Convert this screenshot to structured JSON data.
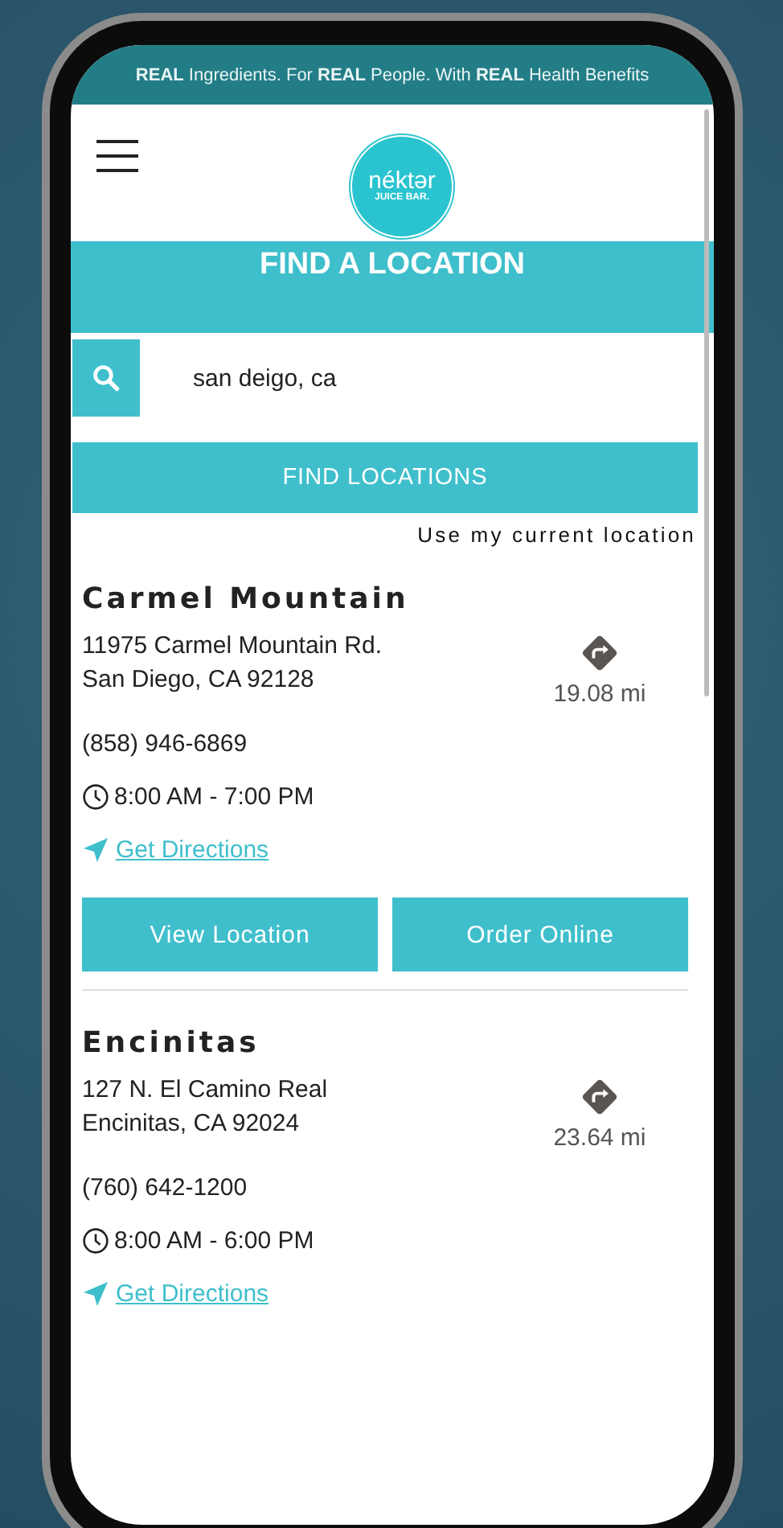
{
  "banner": "**REAL** Ingredients. For **REAL** People. With **REAL** Health Benefits",
  "logo": {
    "wordmark": "néktər",
    "tagline": "JUICE BAR."
  },
  "page_title": "FIND A LOCATION",
  "search": {
    "value": "san deigo, ca"
  },
  "find_button": "FIND LOCATIONS",
  "current_location_link": "Use my current location",
  "locations": [
    {
      "name": "Carmel Mountain",
      "address_line_1": "11975 Carmel Mountain Rd.",
      "address_line_2": "San Diego, CA 92128",
      "phone": "(858) 946-6869",
      "hours": "8:00 AM - 7:00 PM",
      "directions": "Get Directions",
      "distance": "19.08 mi",
      "buttons": [
        "View Location",
        "Order Online"
      ]
    },
    {
      "name": "Encinitas",
      "address_line_1": "127 N. El Camino Real",
      "address_line_2": "Encinitas, CA 92024",
      "phone": "(760) 642-1200",
      "hours": "8:00 AM - 6:00 PM",
      "directions": "Get Directions",
      "distance": "23.64 mi"
    }
  ]
}
